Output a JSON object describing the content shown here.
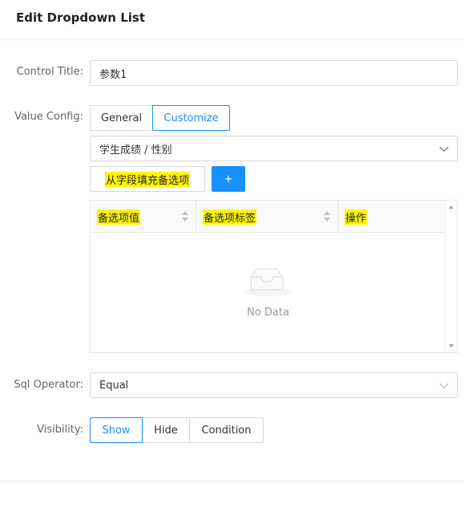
{
  "header": {
    "title": "Edit Dropdown List"
  },
  "control_title": {
    "label": "Control Title:",
    "value": "参数1"
  },
  "value_config": {
    "label": "Value Config:",
    "modes": [
      "General",
      "Customize"
    ],
    "active_mode": "Customize",
    "field_select": "学生成绩 / 性别",
    "fill_button": "从字段填充备选项",
    "add_button": "+",
    "table": {
      "columns": [
        "备选项值",
        "备选项标签",
        "操作"
      ],
      "empty_text": "No Data"
    }
  },
  "sql_operator": {
    "label": "Sql Operator:",
    "value": "Equal"
  },
  "visibility": {
    "label": "Visibility:",
    "options": [
      "Show",
      "Hide",
      "Condition"
    ],
    "active": "Show"
  },
  "colors": {
    "accent": "#1890ff",
    "highlight": "#fff500"
  }
}
